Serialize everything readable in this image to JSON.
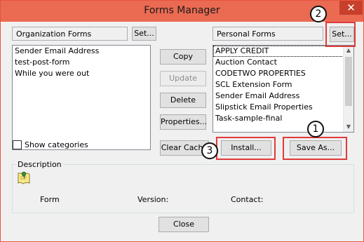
{
  "window": {
    "title": "Forms Manager",
    "close_glyph": "✕"
  },
  "org": {
    "label": "Organization Forms",
    "set_label": "Set...",
    "items": [
      "Sender Email Address",
      "test-post-form",
      "While you were out"
    ]
  },
  "personal": {
    "label": "Personal Forms",
    "set_label": "Set...",
    "items": [
      "APPLY CREDIT",
      "Auction Contact",
      "CODETWO PROPERTIES",
      "SCL Extension Form",
      "Sender Email Address",
      "Slipstick Email Properties",
      "Task-sample-final"
    ]
  },
  "actions": {
    "copy": "Copy",
    "update": "Update",
    "delete": "Delete",
    "properties": "Properties...",
    "clear_cache": "Clear Cache",
    "install": "Install...",
    "save_as": "Save As..."
  },
  "show_categories": {
    "label": "Show categories",
    "checked": false
  },
  "description": {
    "title": "Description",
    "form_label": "Form",
    "version_label": "Version:",
    "contact_label": "Contact:",
    "icon": "form-pin-icon"
  },
  "close_label": "Close",
  "callouts": {
    "badge1": "1",
    "badge2": "2",
    "badge3": "3",
    "color": "#e03a3a"
  }
}
